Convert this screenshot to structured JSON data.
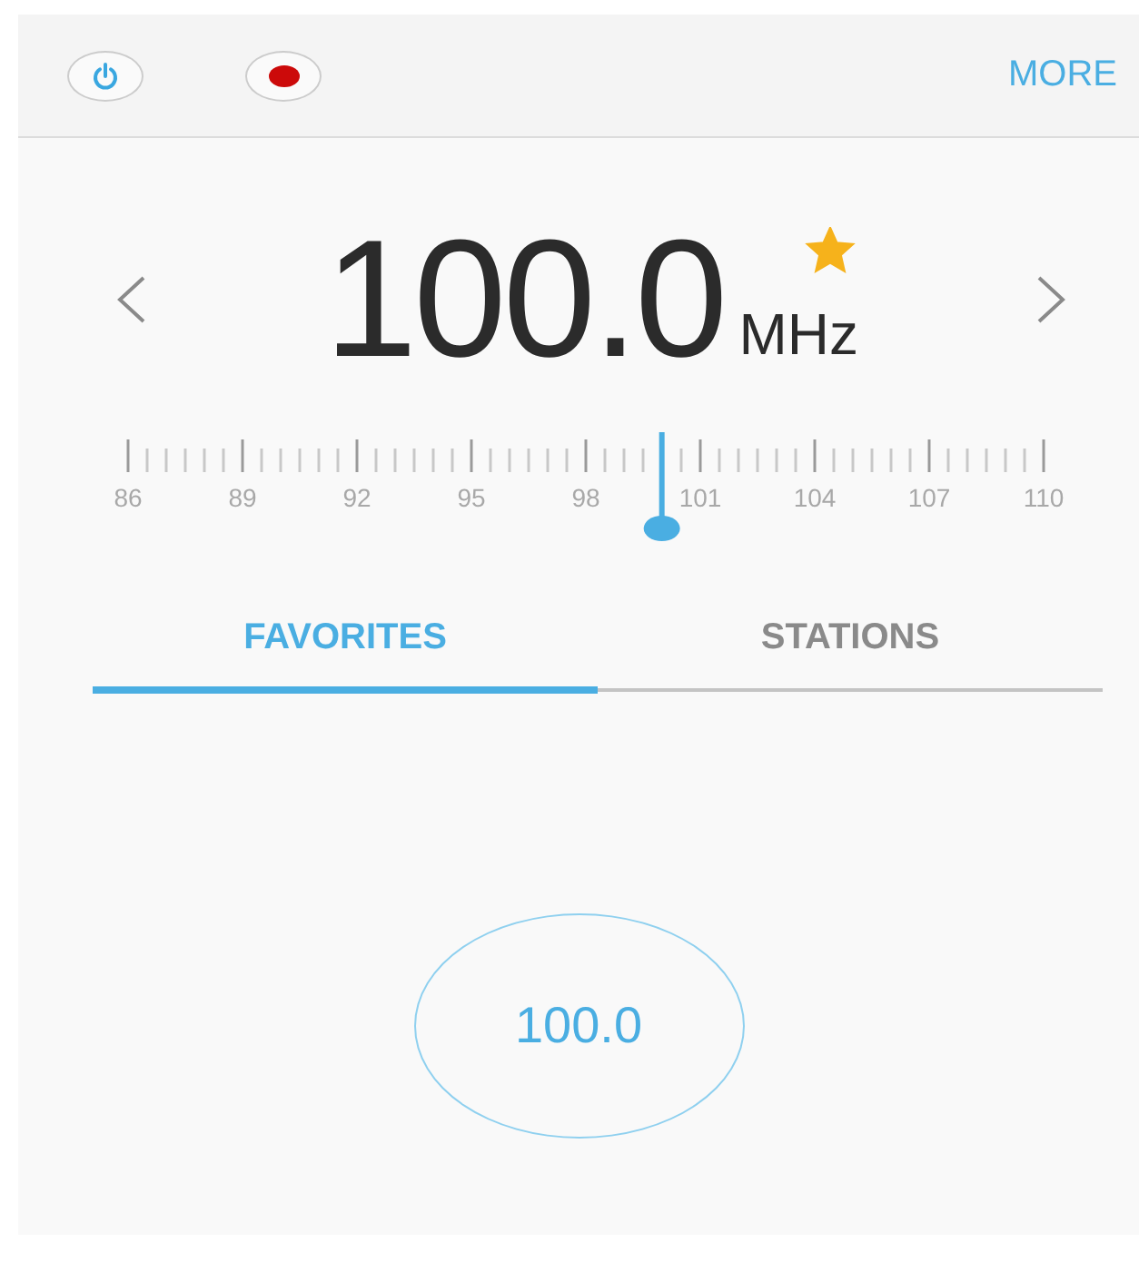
{
  "toolbar": {
    "more_label": "MORE"
  },
  "frequency": {
    "value": "100.0",
    "unit": "MHz",
    "favorite": true
  },
  "dial": {
    "labels": [
      "86",
      "89",
      "92",
      "95",
      "98",
      "101",
      "104",
      "107",
      "110"
    ],
    "level": 0.583
  },
  "tabs": [
    {
      "label": "FAVORITES",
      "selected": true
    },
    {
      "label": "STATIONS",
      "selected": false
    }
  ],
  "favorites": [
    {
      "frequency": "100.0"
    }
  ]
}
